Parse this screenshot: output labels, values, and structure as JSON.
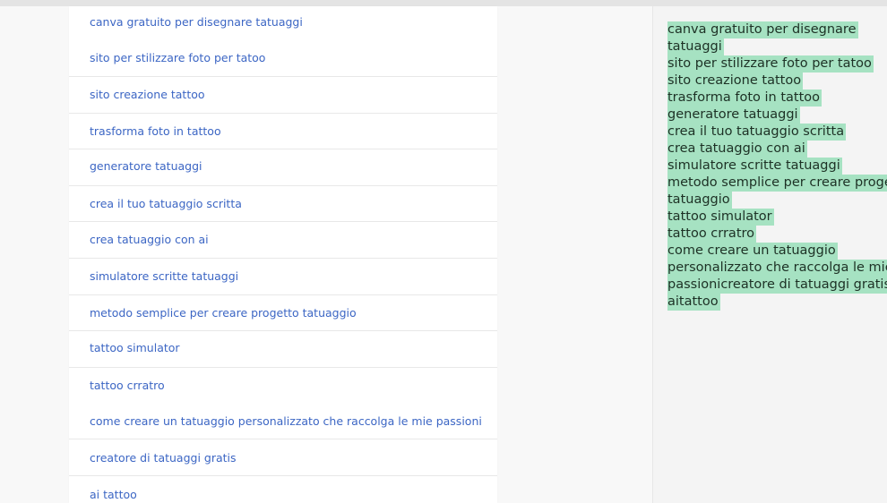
{
  "results": {
    "links": [
      "canva gratuito per disegnare tatuaggi",
      "sito per stilizzare foto per tatoo",
      "sito creazione tattoo",
      "trasforma foto in tattoo",
      "generatore tatuaggi",
      "crea il tuo tatuaggio scritta",
      "crea tatuaggio con ai",
      "simulatore scritte tatuaggi",
      "metodo semplice per creare progetto tatuaggio",
      "tattoo simulator",
      "tattoo crratro",
      "come creare un tatuaggio personalizzato che raccolga le mie passioni",
      "creatore di tatuaggi gratis",
      "ai tattoo"
    ]
  },
  "selection": {
    "lines": [
      "canva gratuito per disegnare",
      "tatuaggi",
      "sito per stilizzare foto per tatoo",
      "sito creazione tattoo",
      "trasforma foto in tattoo",
      "generatore tatuaggi",
      "crea il tuo tatuaggio scritta",
      "crea tatuaggio con ai",
      "simulatore scritte tatuaggi",
      "metodo semplice per creare progetto",
      "tatuaggio",
      "tattoo simulator",
      "tattoo crratro",
      "come creare un tatuaggio",
      "personalizzato che raccolga le mie",
      "passionicreatore di tatuaggi gratis",
      "aitattoo"
    ],
    "highlight_color": "#a6e2c2"
  },
  "colors": {
    "link": "#3c66c4",
    "background": "#f8f8f8"
  }
}
